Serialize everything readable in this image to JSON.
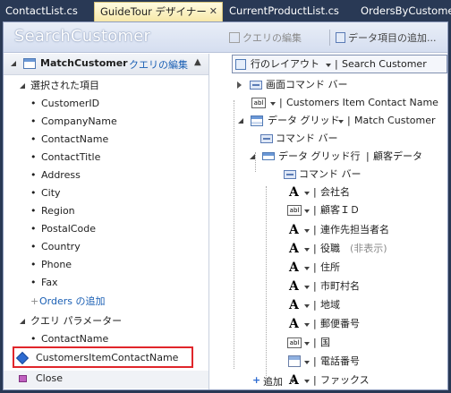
{
  "tabs": [
    {
      "label": "ContactList.cs",
      "active": false
    },
    {
      "label": "GuideTour デザイナー",
      "active": true,
      "close": "✕"
    },
    {
      "label": "CurrentProductList.cs",
      "active": false
    },
    {
      "label": "OrdersByCustome",
      "active": false
    }
  ],
  "header": {
    "title": "SearchCustomer",
    "edit_query": "クエリの編集",
    "add_data_item": "データ項目の追加..."
  },
  "query_panel": {
    "name": "MatchCustomer",
    "edit_link": "クエリの編集",
    "selected_group": "選択された項目",
    "fields": [
      "CustomerID",
      "CompanyName",
      "ContactName",
      "ContactTitle",
      "Address",
      "City",
      "Region",
      "PostalCode",
      "Country",
      "Phone",
      "Fax"
    ],
    "add_orders": "Orders の追加",
    "params_group": "クエリ パラメーター",
    "params": [
      "ContactName",
      "CustomersItemContactName"
    ],
    "close_item": "Close"
  },
  "tree": {
    "root_label": "行のレイアウト",
    "root_value": "Search Customer",
    "screen_command_bar": "画面コマンド バー",
    "item_contact_name": "Customers Item Contact Name",
    "data_grid": "データ グリッド",
    "data_grid_value": "Match Customer",
    "command_bar": "コマンド バー",
    "data_grid_row": "データ グリッド行",
    "data_grid_row_value": "顧客データ",
    "row_command_bar": "コマンド バー",
    "columns": [
      {
        "icon": "A",
        "label": "会社名"
      },
      {
        "icon": "abl",
        "label": "顧客ＩＤ"
      },
      {
        "icon": "A",
        "label": "連作先担当者名"
      },
      {
        "icon": "A",
        "label": "役職",
        "note": "(非表示)"
      },
      {
        "icon": "A",
        "label": "住所"
      },
      {
        "icon": "A",
        "label": "市町村名"
      },
      {
        "icon": "A",
        "label": "地域"
      },
      {
        "icon": "A",
        "label": "郵便番号"
      },
      {
        "icon": "abl",
        "label": "国"
      },
      {
        "icon": "date",
        "label": "電話番号"
      },
      {
        "icon": "A",
        "label": "ファックス"
      }
    ],
    "add_label": "追加"
  },
  "symbols": {
    "pipe": "|",
    "plus": "+",
    "bullet": "•",
    "collapse": "▲"
  }
}
